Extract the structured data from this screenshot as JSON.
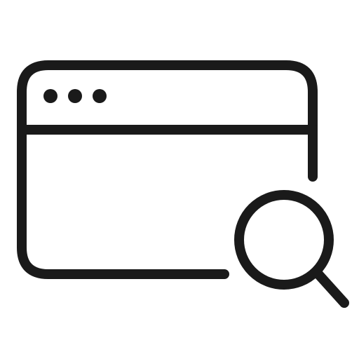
{
  "icon": {
    "name": "browser-window-search-icon",
    "stroke_color": "#1a1a1a",
    "background": "#ffffff",
    "parts": [
      "browser-window-outline",
      "window-header-divider",
      "window-control-dots",
      "magnifier-lens",
      "magnifier-handle"
    ]
  }
}
